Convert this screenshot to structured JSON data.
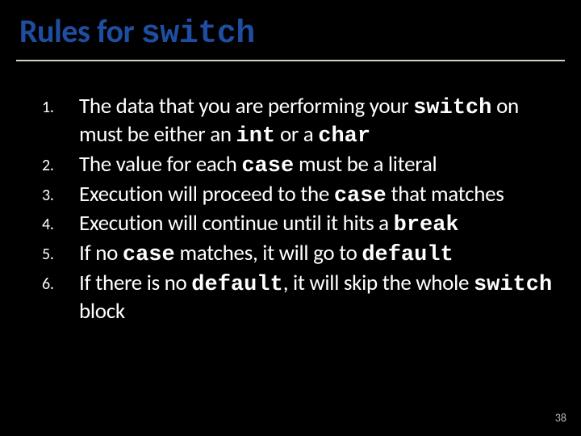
{
  "title": {
    "prefix": "Rules for ",
    "keyword": "switch"
  },
  "rules": [
    {
      "segments": [
        {
          "t": "The data that you are performing your ",
          "mono": false
        },
        {
          "t": "switch",
          "mono": true
        },
        {
          "t": " on must be either an ",
          "mono": false
        },
        {
          "t": "int",
          "mono": true
        },
        {
          "t": " or a ",
          "mono": false
        },
        {
          "t": "char",
          "mono": true
        }
      ]
    },
    {
      "segments": [
        {
          "t": "The value for each ",
          "mono": false
        },
        {
          "t": "case",
          "mono": true
        },
        {
          "t": " must be a literal",
          "mono": false
        }
      ]
    },
    {
      "segments": [
        {
          "t": "Execution will proceed to the ",
          "mono": false
        },
        {
          "t": "case",
          "mono": true
        },
        {
          "t": " that matches",
          "mono": false
        }
      ]
    },
    {
      "segments": [
        {
          "t": "Execution will continue until it hits a ",
          "mono": false
        },
        {
          "t": "break",
          "mono": true
        }
      ]
    },
    {
      "segments": [
        {
          "t": "If no ",
          "mono": false
        },
        {
          "t": "case",
          "mono": true
        },
        {
          "t": " matches, it will go to ",
          "mono": false
        },
        {
          "t": "default",
          "mono": true
        }
      ]
    },
    {
      "segments": [
        {
          "t": "If there is no ",
          "mono": false
        },
        {
          "t": "default",
          "mono": true
        },
        {
          "t": ", it will skip the whole ",
          "mono": false
        },
        {
          "t": "switch",
          "mono": true
        },
        {
          "t": " block",
          "mono": false
        }
      ]
    }
  ],
  "page_number": "38"
}
